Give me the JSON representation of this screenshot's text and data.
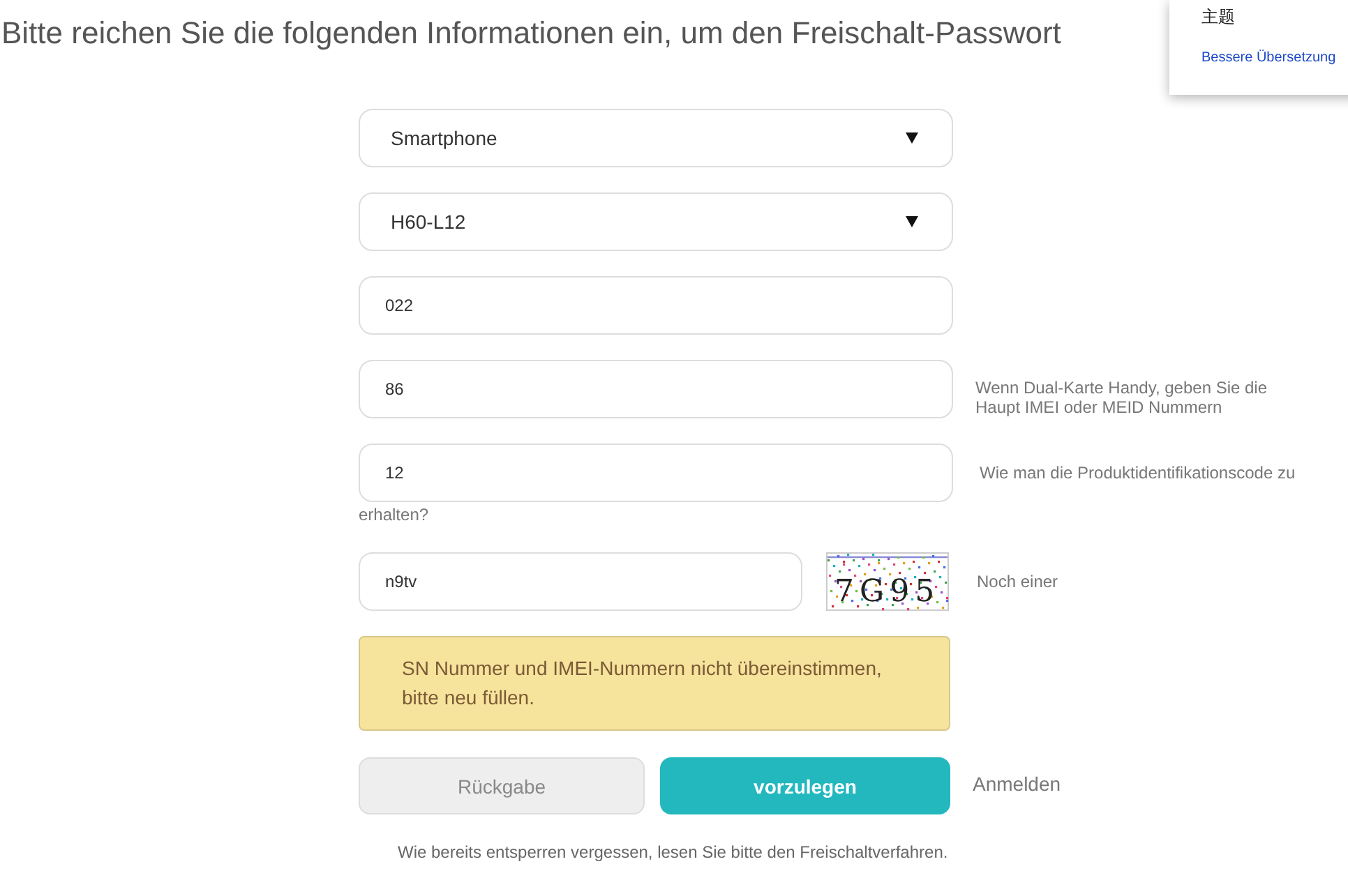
{
  "header": {
    "title": "Bitte reichen Sie die folgenden Informationen ein, um den Freischalt-Passwort"
  },
  "translate_popup": {
    "heading": "主题",
    "link": "Bessere Übersetzung"
  },
  "fields": [
    {
      "kind": "select",
      "value": "Smartphone"
    },
    {
      "kind": "select",
      "value": "H60-L12"
    },
    {
      "kind": "input",
      "value": "022"
    },
    {
      "kind": "input",
      "value": "86",
      "hint": "Wenn Dual-Karte Handy, geben Sie die Haupt IMEI oder MEID Nummern"
    },
    {
      "kind": "input",
      "value": "12",
      "help_link_lines": [
        "Wie man die Produktidentifikationscode zu",
        "erhalten?"
      ]
    }
  ],
  "captcha": {
    "value": "n9tv",
    "code": "7G95",
    "refresh_link": "Noch einer"
  },
  "alert": {
    "message": "SN Nummer und IMEI-Nummern nicht übereinstimmen, bitte neu füllen."
  },
  "buttons": [
    {
      "kind": "secondary",
      "label": "Rückgabe"
    },
    {
      "kind": "primary",
      "label": "vorzulegen"
    }
  ],
  "login_link": "Anmelden",
  "footer_note": "Wie bereits entsperren vergessen, lesen Sie bitte den Freischaltverfahren."
}
